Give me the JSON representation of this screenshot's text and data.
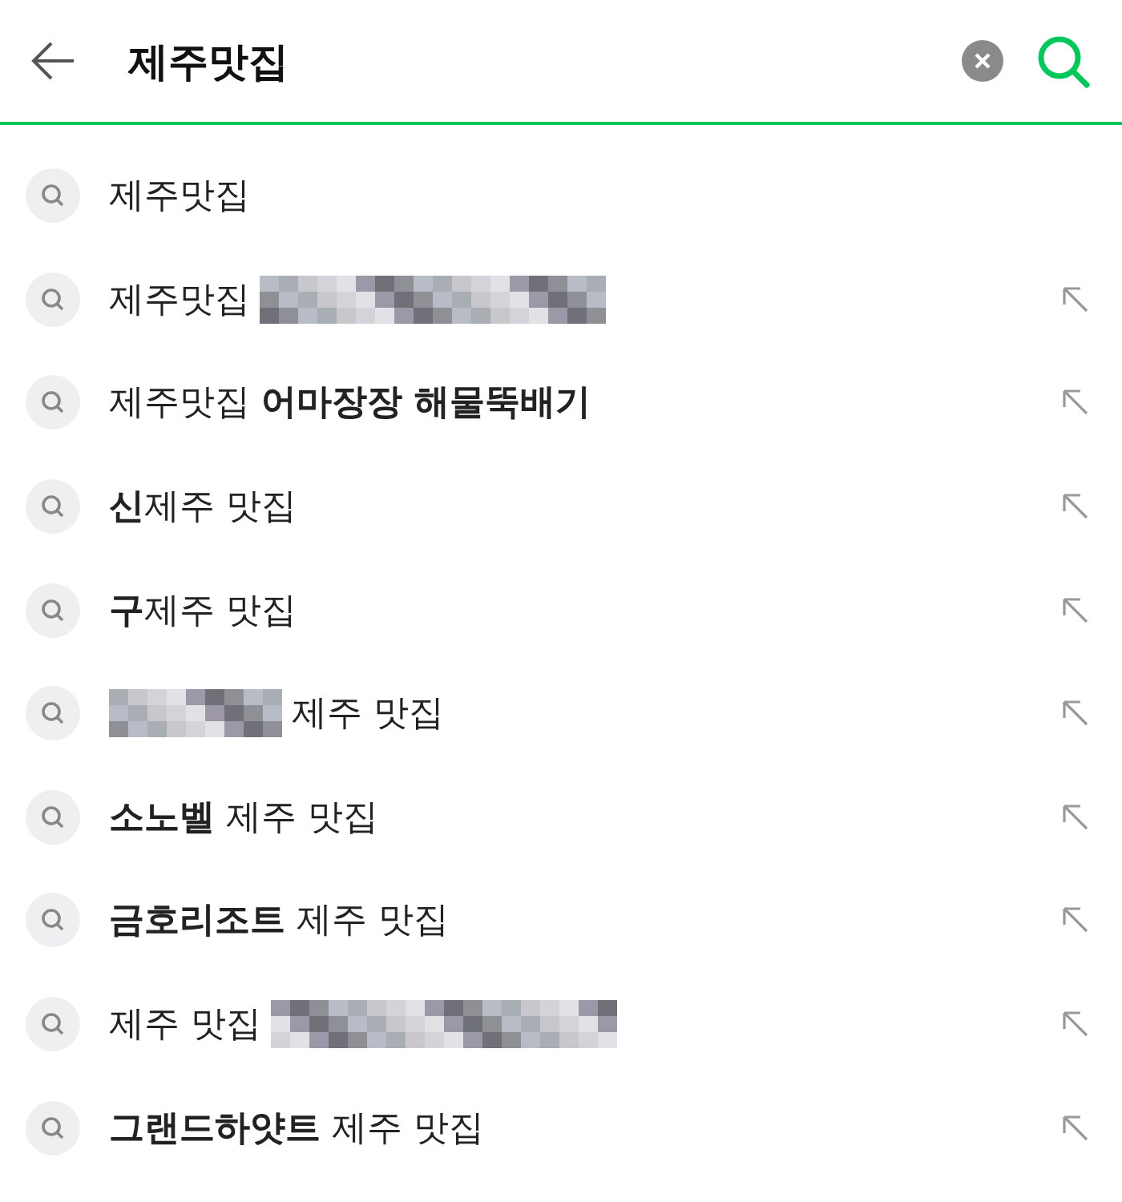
{
  "search": {
    "value": "제주맛집"
  },
  "suggestions": [
    {
      "parts": [
        {
          "kind": "text",
          "text": "제주맛집"
        }
      ],
      "fill_arrow": false
    },
    {
      "parts": [
        {
          "kind": "text",
          "text": "제주맛집"
        },
        {
          "kind": "blur"
        }
      ],
      "fill_arrow": true
    },
    {
      "parts": [
        {
          "kind": "text",
          "text": "제주맛집 **어마장장 해물뚝배기**"
        }
      ],
      "fill_arrow": true
    },
    {
      "parts": [
        {
          "kind": "text",
          "text": "**신**제주 맛집"
        }
      ],
      "fill_arrow": true
    },
    {
      "parts": [
        {
          "kind": "text",
          "text": "**구**제주 맛집"
        }
      ],
      "fill_arrow": true
    },
    {
      "parts": [
        {
          "kind": "blur"
        },
        {
          "kind": "text",
          "text": "제주 맛집"
        }
      ],
      "fill_arrow": true
    },
    {
      "parts": [
        {
          "kind": "text",
          "text": "**소노벨** 제주 맛집"
        }
      ],
      "fill_arrow": true
    },
    {
      "parts": [
        {
          "kind": "text",
          "text": "**금호리조트** 제주 맛집"
        }
      ],
      "fill_arrow": true
    },
    {
      "parts": [
        {
          "kind": "text",
          "text": "제주 맛집"
        },
        {
          "kind": "blur"
        }
      ],
      "fill_arrow": true
    },
    {
      "parts": [
        {
          "kind": "text",
          "text": "**그랜드하얏트** 제주 맛집"
        }
      ],
      "fill_arrow": true
    }
  ]
}
